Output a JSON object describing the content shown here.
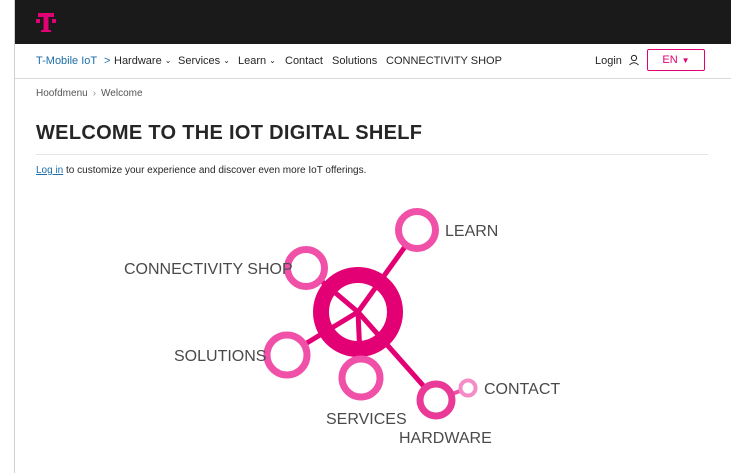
{
  "header": {
    "logo_glyph": "T",
    "brand_color": "#e20074"
  },
  "nav": {
    "brand": "T-Mobile IoT",
    "brand_arrow": ">",
    "items": [
      {
        "label": "Hardware",
        "dropdown": true
      },
      {
        "label": "Services",
        "dropdown": true
      },
      {
        "label": "Learn",
        "dropdown": true
      },
      {
        "label": "Contact",
        "dropdown": false
      },
      {
        "label": "Solutions",
        "dropdown": false
      },
      {
        "label": "CONNECTIVITY SHOP",
        "dropdown": false
      }
    ],
    "login": "Login",
    "language": "EN"
  },
  "breadcrumb": {
    "items": [
      "Hoofdmenu",
      "Welcome"
    ],
    "separator": "›"
  },
  "page": {
    "title": "WELCOME TO THE IOT DIGITAL SHELF",
    "intro_link": "Log in",
    "intro_text": " to customize your experience and discover even more IoT offerings."
  },
  "diagram": {
    "labels": {
      "learn": "LEARN",
      "connectivity_shop": "CONNECTIVITY SHOP",
      "solutions": "SOLUTIONS",
      "services": "SERVICES",
      "hardware": "HARDWARE",
      "contact": "CONTACT"
    },
    "colors": {
      "hub": "#e20074",
      "node": "#f050a8",
      "node_light": "#f58cc8",
      "label": "#4a4a4a"
    }
  }
}
